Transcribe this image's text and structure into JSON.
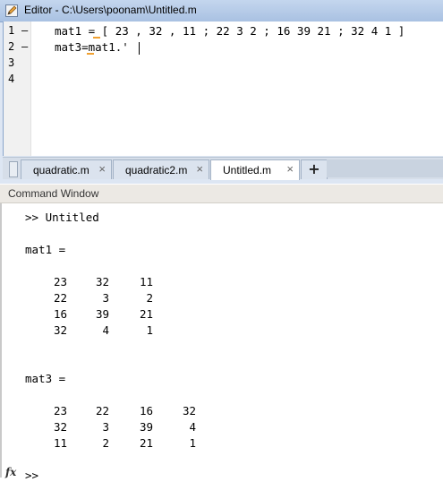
{
  "editor": {
    "title": "Editor - C:\\Users\\poonam\\Untitled.m",
    "line_numbers": [
      "1",
      "2",
      "3",
      "4"
    ],
    "breakpoint_marks": [
      "–",
      "–"
    ],
    "code_lines": [
      "mat1 = [ 23 , 32 , 11 ; 22 3 2 ; 16 39 21 ; 32 4 1 ]",
      "mat3=mat1.'"
    ],
    "tabs": [
      {
        "label": "quadratic.m",
        "close": "×"
      },
      {
        "label": "quadratic2.m",
        "close": "×"
      },
      {
        "label": "Untitled.m",
        "close": "×"
      }
    ],
    "add_tab": "+"
  },
  "command_window": {
    "title": "Command Window",
    "command": ">> Untitled",
    "mat1_label": "mat1 =",
    "mat1_rows": [
      [
        "23",
        "32",
        "11"
      ],
      [
        "22",
        "3",
        "2"
      ],
      [
        "16",
        "39",
        "21"
      ],
      [
        "32",
        "4",
        "1"
      ]
    ],
    "mat3_label": "mat3 =",
    "mat3_rows": [
      [
        "23",
        "22",
        "16",
        "32"
      ],
      [
        "32",
        "3",
        "39",
        "4"
      ],
      [
        "11",
        "2",
        "21",
        "1"
      ]
    ],
    "fx_label": "fx",
    "prompt": ">>"
  },
  "colors": {
    "warning_underline": "#f0a030",
    "titlebar": "#b7cce8"
  }
}
